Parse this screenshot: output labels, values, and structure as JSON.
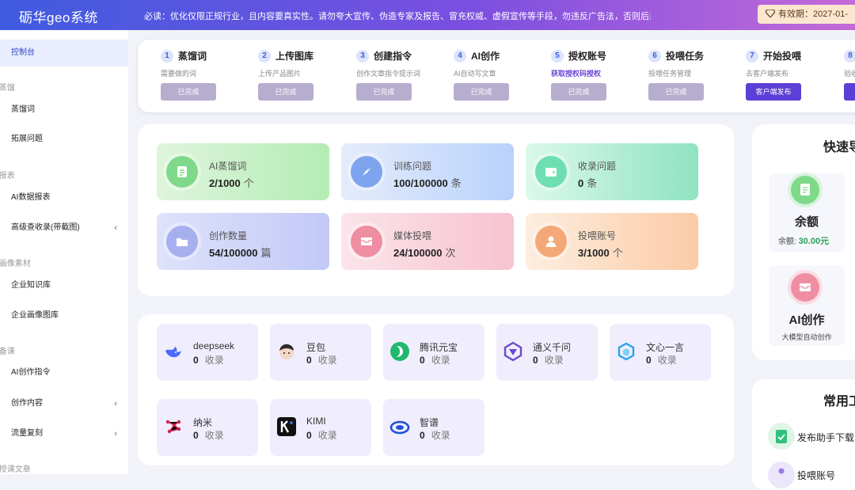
{
  "topbar": {
    "brand": "砺华geo系统",
    "notice": "必读：优化仅限正规行业，且内容要真实性。请勿夸大宣传、伪造专家及报告、冒充权威、虚假宣传等手段，勿违反广告法，否则后果...",
    "expire": "有效期：2027-01-"
  },
  "sidebar": {
    "dashboard": "控制台",
    "group_distill": "I蒸馏",
    "distill_words": "蒸馏词",
    "expand_questions": "拓展问题",
    "group_report": "I报表",
    "ai_report": "AI数据报表",
    "advanced_query": "高级查收录(带截图)",
    "group_material": "I画像素材",
    "knowledge_base": "企业知识库",
    "image_library": "企业画像图库",
    "group_prepare": "I备课",
    "ai_instructions": "AI创作指令",
    "create_content": "创作内容",
    "traffic_copy": "流量复刻",
    "group_bottom": "I授课文章"
  },
  "steps": [
    {
      "num": "1",
      "title": "蒸馏词",
      "desc": "需要做的词",
      "button": "已完成"
    },
    {
      "num": "2",
      "title": "上传图库",
      "desc": "上传产品图片",
      "button": "已完成"
    },
    {
      "num": "3",
      "title": "创建指令",
      "desc": "创作文章指令提示词",
      "button": "已完成"
    },
    {
      "num": "4",
      "title": "AI创作",
      "desc": "AI自动写文章",
      "button": "已完成"
    },
    {
      "num": "5",
      "title": "授权账号",
      "desc": "获取授权码授权",
      "button": "已完成"
    },
    {
      "num": "6",
      "title": "投喂任务",
      "desc": "投喂任务管理",
      "button": "已完成"
    },
    {
      "num": "7",
      "title": "开始投喂",
      "desc": "去客户端发布",
      "button": "客户端发布"
    },
    {
      "num": "8",
      "title": "",
      "desc": "验收",
      "button": ""
    }
  ],
  "stats": [
    {
      "label": "AI蒸馏词",
      "value": "2/1000",
      "unit": "个"
    },
    {
      "label": "训练问题",
      "value": "100/100000",
      "unit": "条"
    },
    {
      "label": "收录问题",
      "value": "0",
      "unit": "条"
    },
    {
      "label": "创作数量",
      "value": "54/100000",
      "unit": "篇"
    },
    {
      "label": "媒体投喂",
      "value": "24/100000",
      "unit": "次"
    },
    {
      "label": "投喂账号",
      "value": "3/1000",
      "unit": "个"
    }
  ],
  "ai_platforms": [
    {
      "name": "deepseek",
      "count": "0",
      "unit": "收录"
    },
    {
      "name": "豆包",
      "count": "0",
      "unit": "收录"
    },
    {
      "name": "腾讯元宝",
      "count": "0",
      "unit": "收录"
    },
    {
      "name": "通义千问",
      "count": "0",
      "unit": "收录"
    },
    {
      "name": "文心一言",
      "count": "0",
      "unit": "收录"
    },
    {
      "name": "纳米",
      "count": "0",
      "unit": "收录"
    },
    {
      "name": "KIMI",
      "count": "0",
      "unit": "收录"
    },
    {
      "name": "智谱",
      "count": "0",
      "unit": "收录"
    }
  ],
  "quick_nav": {
    "title": "快速导",
    "balance_title": "余额",
    "balance_label": "余额:",
    "balance_value": "30.00元",
    "ai_title": "AI创作",
    "ai_desc": "大模型自动创作"
  },
  "common_tools": {
    "title": "常用工",
    "item1": "发布助手下载",
    "item2": "投喂账号"
  },
  "colors": {
    "accent": "#3f5be0",
    "primary_button": "#5b3fd6",
    "done_button": "#b7adcf",
    "balance_green": "#2aa05a"
  }
}
